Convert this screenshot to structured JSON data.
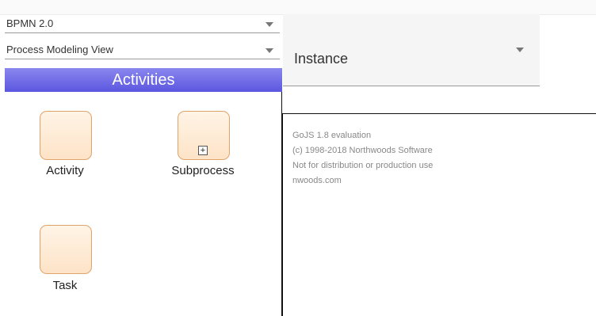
{
  "diagram_type_select": {
    "value": "BPMN 2.0"
  },
  "view_select": {
    "value": "Process Modeling View"
  },
  "palette": {
    "header": "Activities",
    "items": [
      {
        "label": "Activity"
      },
      {
        "label": "Subprocess",
        "marker": "+"
      },
      {
        "label": "Task"
      }
    ]
  },
  "instance_select": {
    "value": "Instance"
  },
  "canvas": {
    "watermark": [
      "GoJS 1.8 evaluation",
      "(c) 1998-2018 Northwoods Software",
      "Not for distribution or production use",
      "nwoods.com"
    ]
  },
  "colors": {
    "palette_header": "#5b57df",
    "node_fill": "#fde3c7",
    "node_border": "#e0a36a"
  }
}
